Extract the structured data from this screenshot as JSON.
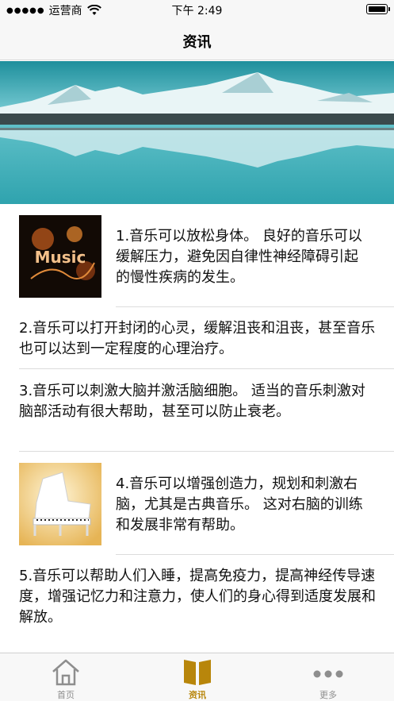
{
  "status_bar": {
    "carrier": "运营商",
    "time": "下午 2:49"
  },
  "nav": {
    "title": "资讯"
  },
  "banner": {
    "image": "mountain-lake-photo"
  },
  "news": [
    {
      "text": "1.音乐可以放松身体。 良好的音乐可以缓解压力，避免因自律性神经障碍引起的慢性疾病的发生。",
      "thumb_caption": "Music"
    },
    {
      "text": "2.音乐可以打开封闭的心灵，缓解沮丧和沮丧，甚至音乐也可以达到一定程度的心理治疗。"
    },
    {
      "text": "3.音乐可以刺激大脑并激活脑细胞。 适当的音乐刺激对脑部活动有很大帮助，甚至可以防止衰老。"
    },
    {
      "text": "4.音乐可以增强创造力，规划和刺激右脑，尤其是古典音乐。 这对右脑的训练和发展非常有帮助。",
      "thumb_image": "white-piano-photo"
    },
    {
      "text": "5.音乐可以帮助人们入睡，提高免疫力，提高神经传导速度，增强记忆力和注意力，使人们的身心得到适度发展和解放。"
    }
  ],
  "tabs": [
    {
      "label": "首页",
      "icon": "home-icon",
      "active": false
    },
    {
      "label": "资讯",
      "icon": "book-icon",
      "active": true
    },
    {
      "label": "更多",
      "icon": "more-icon",
      "active": false
    }
  ],
  "colors": {
    "accent": "#b8860b",
    "inactive": "#8e8e8e",
    "bar_bg": "#f7f7f7"
  }
}
